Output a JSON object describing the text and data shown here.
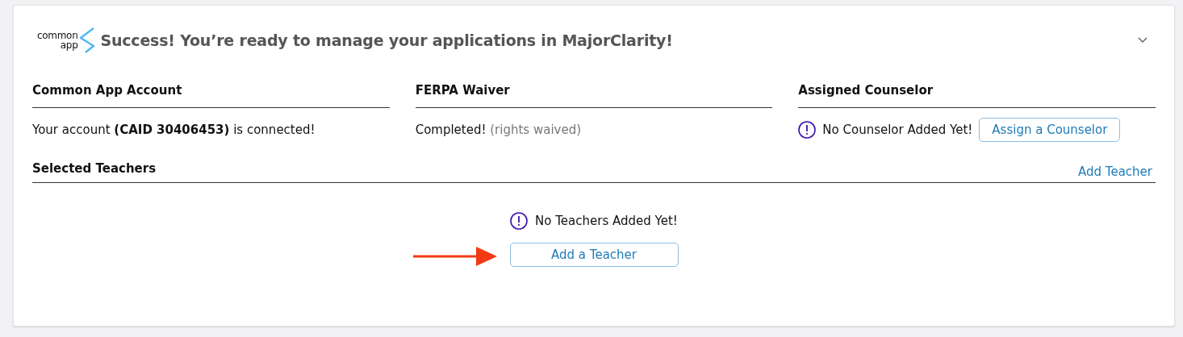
{
  "header": {
    "logo_lines": [
      "common",
      "app"
    ],
    "title": "Success! You’re ready to manage your applications in MajorClarity!"
  },
  "sections": [
    {
      "heading": "Common App Account",
      "kind": "text",
      "text": "Your account **(CAID 30406453)** is connected!"
    },
    {
      "heading": "FERPA Waiver",
      "kind": "note",
      "text": "Completed!",
      "note": "(rights waived)"
    },
    {
      "heading": "Assigned Counselor",
      "kind": "empty",
      "text": "No Counselor Added Yet!",
      "button": "Assign a Counselor"
    }
  ],
  "teachers": {
    "heading": "Selected Teachers",
    "link": "Add Teacher",
    "empty_text": "No Teachers Added Yet!",
    "button": "Add a Teacher"
  }
}
